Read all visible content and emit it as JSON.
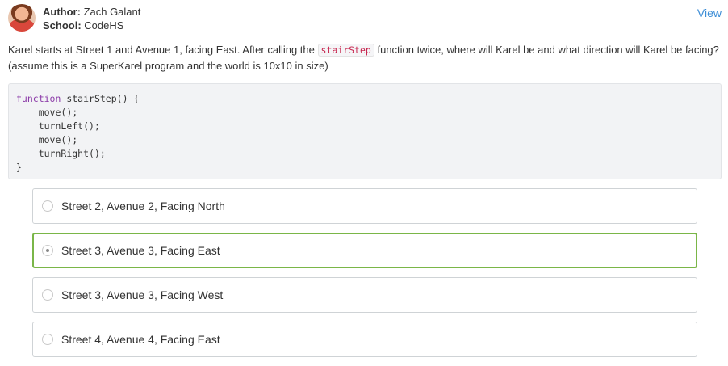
{
  "header": {
    "author_label": "Author:",
    "author_name": "Zach Galant",
    "school_label": "School:",
    "school_name": "CodeHS",
    "view_link": "View"
  },
  "question": {
    "text_before": "Karel starts at Street 1 and Avenue 1, facing East. After calling the",
    "inline_code": "stairStep",
    "text_after": "function twice, where will Karel be and what direction will Karel be facing? (assume this is a SuperKarel program and the world is 10x10 in size)"
  },
  "code": {
    "keyword": "function",
    "signature": "stairStep() {",
    "lines": [
      "move();",
      "turnLeft();",
      "move();",
      "turnRight();"
    ],
    "closing": "}"
  },
  "options": [
    {
      "label": "Street 2, Avenue 2, Facing North",
      "selected": false
    },
    {
      "label": "Street 3, Avenue 3, Facing East",
      "selected": true
    },
    {
      "label": "Street 3, Avenue 3, Facing West",
      "selected": false
    },
    {
      "label": "Street 4, Avenue 4, Facing East",
      "selected": false
    }
  ],
  "colors": {
    "selected_border": "#7ab648",
    "link": "#3c8dd6",
    "inline_code": "#c7254e"
  }
}
